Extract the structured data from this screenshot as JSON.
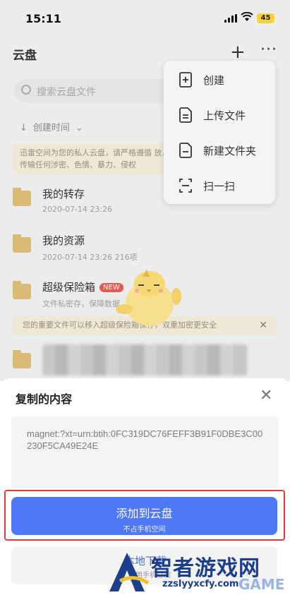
{
  "status": {
    "time": "15:11",
    "battery": "45"
  },
  "header": {
    "title": "云盘"
  },
  "search": {
    "placeholder": "搜索云盘文件"
  },
  "sort": {
    "label": "创建时间"
  },
  "notice": {
    "text": "迅雷空间为您的私人云盘，请严格遵循 放、传输任何涉密、色情、暴力、侵权"
  },
  "files": [
    {
      "name": "我的转存",
      "meta": "2020-07-14 23:26"
    },
    {
      "name": "我的资源",
      "meta": "2020-07-14 23:26  216项"
    },
    {
      "name": "超级保险箱",
      "badge": "NEW",
      "meta": "文件私密存，保障数据"
    }
  ],
  "notice2": {
    "text": "您的重要文件可以移入超级保险箱保存，双重加密更安全"
  },
  "menu": {
    "items": [
      {
        "label": "创建",
        "icon": "create-icon"
      },
      {
        "label": "上传文件",
        "icon": "upload-file-icon"
      },
      {
        "label": "新建文件夹",
        "icon": "new-folder-icon"
      },
      {
        "label": "扫一扫",
        "icon": "scan-icon"
      }
    ]
  },
  "sheet": {
    "title": "复制的内容",
    "content": "magnet:?xt=urn:btih:0FC319DC76FEFF3B91F0DBE3C00230F5CA49E24E",
    "primary": {
      "label": "添加到云盘",
      "sub": "不占手机空间"
    },
    "secondary": {
      "label": "本地下载",
      "sub": "占用手机空间"
    }
  },
  "watermark": {
    "text": "智者游戏网",
    "url": "zzslyyxcfy.com",
    "tag": "GAME"
  },
  "colors": {
    "accent": "#4f78f5",
    "highlight": "#e23a3a",
    "badge": "#e25a53",
    "folder": "#d9bb76"
  }
}
